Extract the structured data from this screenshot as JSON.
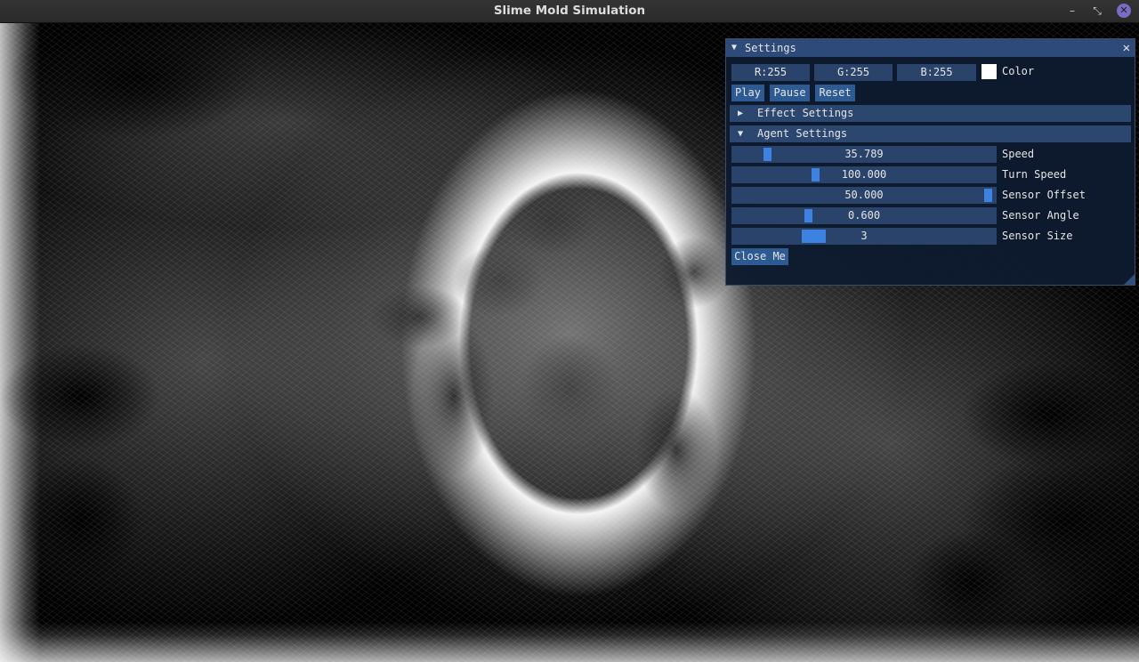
{
  "window": {
    "title": "Slime Mold Simulation",
    "minimize_glyph": "–",
    "maximize_glyph": "⤡",
    "close_glyph": "✕"
  },
  "settings": {
    "title": "Settings",
    "collapse_glyph": "▼",
    "close_glyph": "✕",
    "color": {
      "r_field": "R:255",
      "g_field": "G:255",
      "b_field": "B:255",
      "swatch_hex": "#ffffff",
      "label": "Color"
    },
    "buttons": {
      "play": "Play",
      "pause": "Pause",
      "reset": "Reset"
    },
    "effect_header": {
      "glyph": "▶",
      "label": "Effect Settings"
    },
    "agent_header": {
      "glyph": "▼",
      "label": "Agent Settings"
    },
    "sliders": [
      {
        "value": "35.789",
        "label": "Speed",
        "fraction": 0.12
      },
      {
        "value": "100.000",
        "label": "Turn Speed",
        "fraction": 0.31
      },
      {
        "value": "50.000",
        "label": "Sensor Offset",
        "fraction": 0.99
      },
      {
        "value": "0.600",
        "label": "Sensor Angle",
        "fraction": 0.28
      },
      {
        "value": "3",
        "label": "Sensor Size",
        "fraction": 0.29
      }
    ],
    "close_me": "Close Me"
  },
  "colors": {
    "panel_bg": "#0e1a2e",
    "title_bg": "#2d4a78",
    "frame_bg": "#29436a",
    "button_bg": "#2e5a94",
    "slider_grab": "#3d82e0",
    "close_circle": "#7c6bc3"
  }
}
